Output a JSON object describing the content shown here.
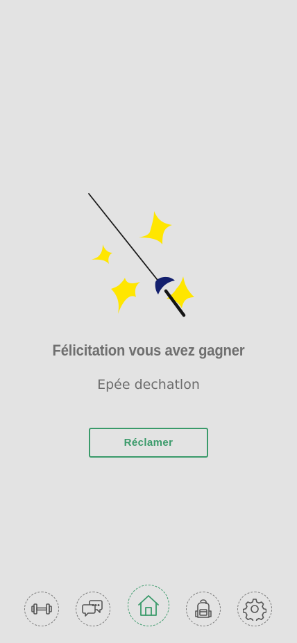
{
  "reward": {
    "title": "Félicitation vous avez gagner",
    "item_name": "Epée dechatlon",
    "claim_label": "Réclamer",
    "illustration": "fencing-sword-with-sparkles"
  },
  "colors": {
    "background": "#e3e3e3",
    "accent": "#3a9a6a",
    "text": "#6f6f6f",
    "sparkle": "#ffe600",
    "guard": "#14206e"
  },
  "bottom_nav": {
    "items": [
      {
        "icon": "dumbbell-icon",
        "active": false
      },
      {
        "icon": "chat-icon",
        "active": false
      },
      {
        "icon": "home-icon",
        "active": true
      },
      {
        "icon": "backpack-icon",
        "active": false
      },
      {
        "icon": "gear-icon",
        "active": false
      }
    ]
  }
}
